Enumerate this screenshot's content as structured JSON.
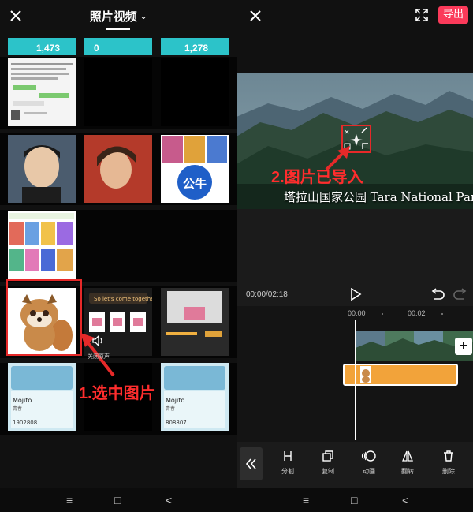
{
  "left_panel": {
    "title": "照片视频",
    "title_chevron": "⌄",
    "annotation": "1.选中图片",
    "thumbnails": {
      "stat_cards": [
        "1,473",
        "0",
        "1,278"
      ],
      "mojito_title": "Mojito",
      "mojito_sub": "青春",
      "mojito_count_1": "1902808",
      "mojito_count_2": "808807",
      "promo_text": "So let's come together",
      "gongniu_text": "公牛"
    }
  },
  "editor": {
    "export_label": "导出",
    "annotation": "2.图片已导入",
    "video_caption": "塔拉山国家公园 Tara National Park",
    "time_display": "00:00/02:18",
    "timeline_ticks": [
      "00:00",
      "00:02"
    ],
    "mute_label": "关闭原声",
    "add_label": "+",
    "tools": [
      {
        "label": "分割",
        "icon": "split-icon"
      },
      {
        "label": "复制",
        "icon": "copy-icon"
      },
      {
        "label": "动画",
        "icon": "animation-icon"
      },
      {
        "label": "翻转",
        "icon": "flip-icon"
      },
      {
        "label": "删除",
        "icon": "delete-icon"
      }
    ]
  },
  "nav": {
    "menu": "≡",
    "home": "□",
    "back": "<"
  },
  "colors": {
    "accent_red": "#e62929",
    "export_pink": "#fb3a5a",
    "sticker_orange": "#f2a33a"
  }
}
